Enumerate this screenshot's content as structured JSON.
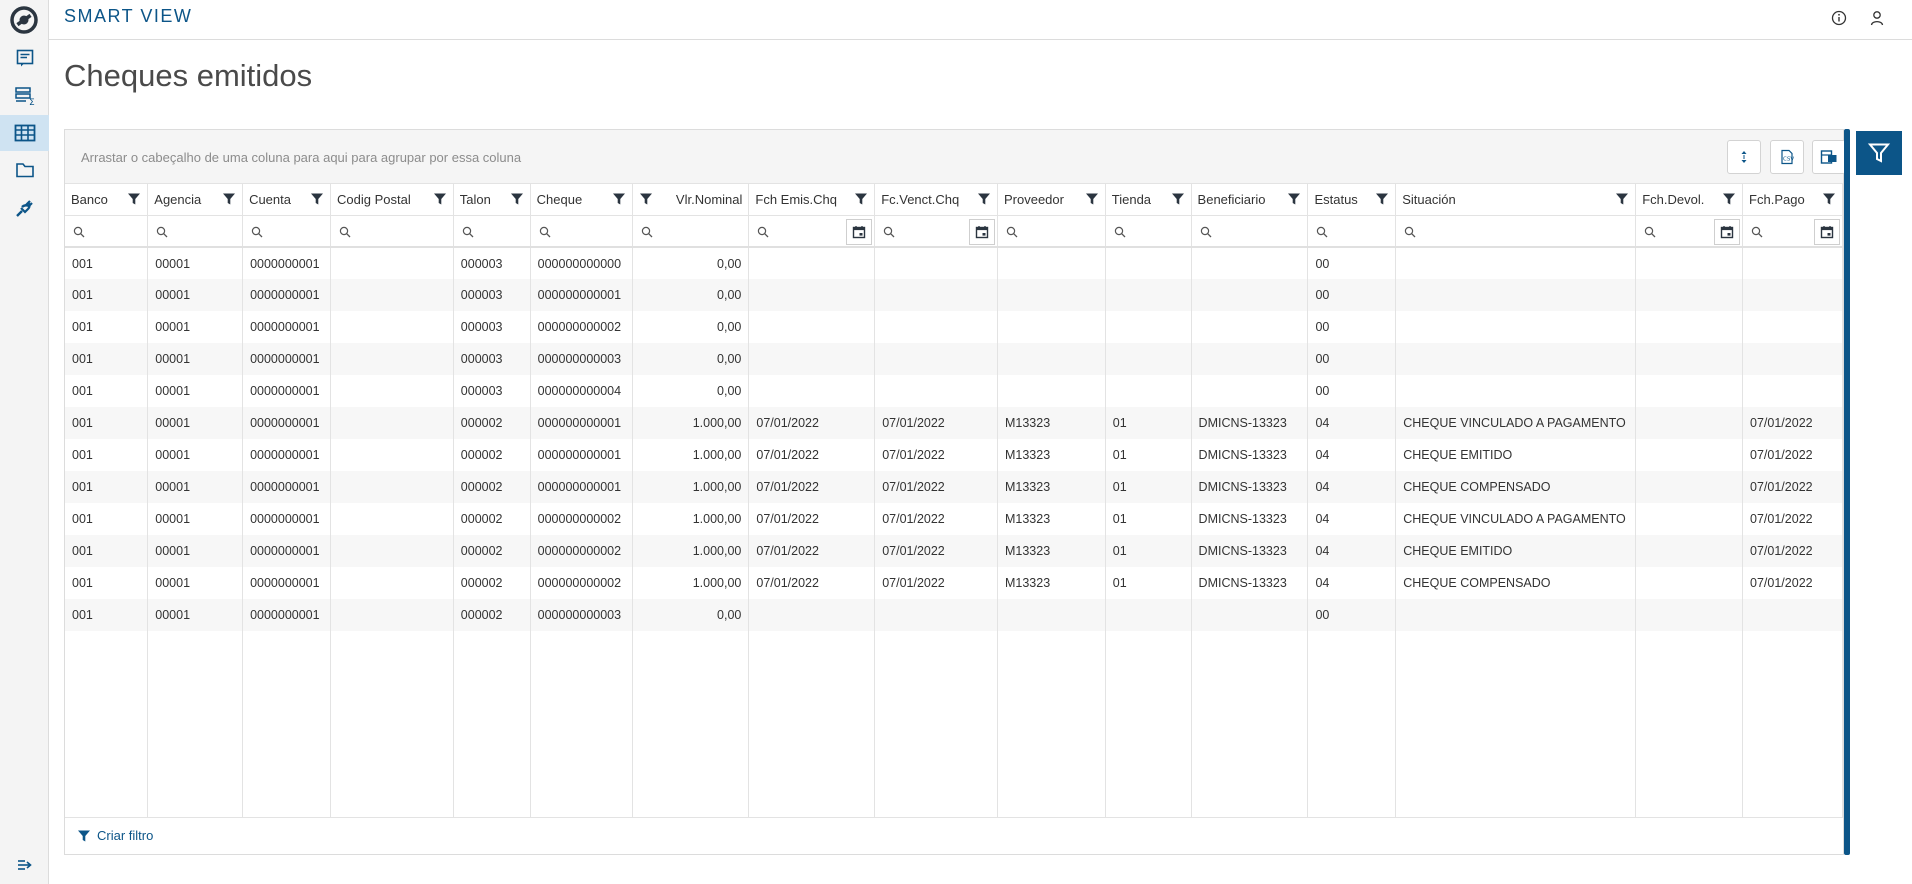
{
  "app": {
    "brand": "SMART VIEW"
  },
  "page": {
    "title": "Cheques emitidos"
  },
  "rail": {
    "items": [
      {
        "icon": "report-icon"
      },
      {
        "icon": "sum-list-icon"
      },
      {
        "icon": "table-grid-icon",
        "active": true
      },
      {
        "icon": "folder-icon"
      },
      {
        "icon": "plug-icon"
      }
    ],
    "collapse_icon": "expand-menu-icon"
  },
  "header_icons": [
    "info-icon",
    "user-icon"
  ],
  "grid": {
    "group_placeholder": "Arrastar o cabeçalho de uma coluna para aqui para agrupar por essa coluna",
    "toolbar_icons": [
      "row-height-icon",
      "export-icon",
      "columns-icon"
    ],
    "columns": [
      {
        "label": "Banco"
      },
      {
        "label": "Agencia"
      },
      {
        "label": "Cuenta"
      },
      {
        "label": "Codig Postal"
      },
      {
        "label": "Talon"
      },
      {
        "label": "Cheque"
      },
      {
        "label": "Vlr.Nominal",
        "align": "right",
        "filter_left": true
      },
      {
        "label": "Fch Emis.Chq",
        "date": true
      },
      {
        "label": "Fc.Venct.Chq",
        "date": true
      },
      {
        "label": "Proveedor"
      },
      {
        "label": "Tienda"
      },
      {
        "label": "Beneficiario"
      },
      {
        "label": "Estatus"
      },
      {
        "label": "Situación"
      },
      {
        "label": "Fch.Devol.",
        "date": true
      },
      {
        "label": "Fch.Pago",
        "date": true
      }
    ],
    "rows": [
      [
        "001",
        "00001",
        "0000000001",
        "",
        "000003",
        "000000000000",
        "0,00",
        "",
        "",
        "",
        "",
        "",
        "00",
        "",
        "",
        ""
      ],
      [
        "001",
        "00001",
        "0000000001",
        "",
        "000003",
        "000000000001",
        "0,00",
        "",
        "",
        "",
        "",
        "",
        "00",
        "",
        "",
        ""
      ],
      [
        "001",
        "00001",
        "0000000001",
        "",
        "000003",
        "000000000002",
        "0,00",
        "",
        "",
        "",
        "",
        "",
        "00",
        "",
        "",
        ""
      ],
      [
        "001",
        "00001",
        "0000000001",
        "",
        "000003",
        "000000000003",
        "0,00",
        "",
        "",
        "",
        "",
        "",
        "00",
        "",
        "",
        ""
      ],
      [
        "001",
        "00001",
        "0000000001",
        "",
        "000003",
        "000000000004",
        "0,00",
        "",
        "",
        "",
        "",
        "",
        "00",
        "",
        "",
        ""
      ],
      [
        "001",
        "00001",
        "0000000001",
        "",
        "000002",
        "000000000001",
        "1.000,00",
        "07/01/2022",
        "07/01/2022",
        "M13323",
        "01",
        "DMICNS-13323",
        "04",
        "CHEQUE VINCULADO A PAGAMENTO",
        "",
        "07/01/2022"
      ],
      [
        "001",
        "00001",
        "0000000001",
        "",
        "000002",
        "000000000001",
        "1.000,00",
        "07/01/2022",
        "07/01/2022",
        "M13323",
        "01",
        "DMICNS-13323",
        "04",
        "CHEQUE EMITIDO",
        "",
        "07/01/2022"
      ],
      [
        "001",
        "00001",
        "0000000001",
        "",
        "000002",
        "000000000001",
        "1.000,00",
        "07/01/2022",
        "07/01/2022",
        "M13323",
        "01",
        "DMICNS-13323",
        "04",
        "CHEQUE COMPENSADO",
        "",
        "07/01/2022"
      ],
      [
        "001",
        "00001",
        "0000000001",
        "",
        "000002",
        "000000000002",
        "1.000,00",
        "07/01/2022",
        "07/01/2022",
        "M13323",
        "01",
        "DMICNS-13323",
        "04",
        "CHEQUE VINCULADO A PAGAMENTO",
        "",
        "07/01/2022"
      ],
      [
        "001",
        "00001",
        "0000000001",
        "",
        "000002",
        "000000000002",
        "1.000,00",
        "07/01/2022",
        "07/01/2022",
        "M13323",
        "01",
        "DMICNS-13323",
        "04",
        "CHEQUE EMITIDO",
        "",
        "07/01/2022"
      ],
      [
        "001",
        "00001",
        "0000000001",
        "",
        "000002",
        "000000000002",
        "1.000,00",
        "07/01/2022",
        "07/01/2022",
        "M13323",
        "01",
        "DMICNS-13323",
        "04",
        "CHEQUE COMPENSADO",
        "",
        "07/01/2022"
      ],
      [
        "001",
        "00001",
        "0000000001",
        "",
        "000002",
        "000000000003",
        "0,00",
        "",
        "",
        "",
        "",
        "",
        "00",
        "",
        "",
        ""
      ]
    ],
    "footer_label": "Criar filtro"
  },
  "colors": {
    "brand": "#0c5588",
    "active_nav": "#cfe3f2"
  }
}
